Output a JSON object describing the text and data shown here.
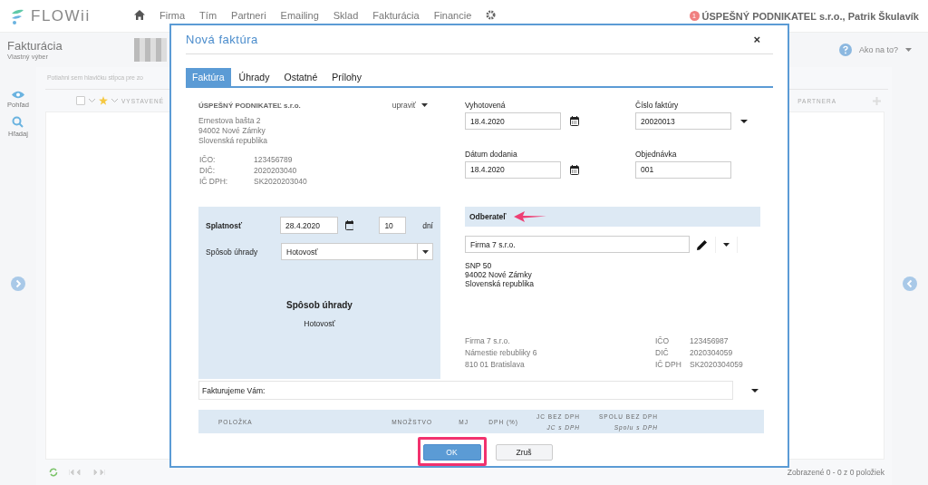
{
  "app": {
    "logo": "FLOWii",
    "nav": [
      "Firma",
      "Tím",
      "Partneri",
      "Emailing",
      "Sklad",
      "Fakturácia",
      "Financie"
    ],
    "notification_count": "1",
    "user": "ÚSPEŠNÝ PODNIKATEĽ s.r.o., Patrik Škulavík"
  },
  "page": {
    "title": "Fakturácia",
    "subtitle": "Vlastný výber",
    "help": "Ako na to?"
  },
  "sidebar": [
    {
      "label": "Pohľad",
      "kind": "view"
    },
    {
      "label": "Hľadaj",
      "kind": "search"
    }
  ],
  "grid": {
    "select_all_checked": false,
    "group_hint": "Potiahni sem hlavičku stĺpca pre zo",
    "columns": [
      "VYSTAVENÉ",
      "PARTNERA"
    ],
    "footer": "Zobrazené 0 - 0 z 0 položiek"
  },
  "dialog": {
    "title": "Nová faktúra",
    "close": "×",
    "tabs": [
      {
        "label": "Faktúra",
        "selected": true
      },
      {
        "label": "Úhrady",
        "selected": false
      },
      {
        "label": "Ostatné",
        "selected": false
      },
      {
        "label": "Prílohy",
        "selected": false
      }
    ],
    "supplier": {
      "name": "ÚSPEŠNÝ PODNIKATEĽ s.r.o.",
      "edit": "upraviť",
      "address": [
        "Ernestova bašta 2",
        "94002 Nové Zámky",
        "Slovenská republika"
      ],
      "ids": [
        {
          "label": "IČO:",
          "value": "123456789"
        },
        {
          "label": "DIČ:",
          "value": "2020203040"
        },
        {
          "label": "IČ DPH:",
          "value": "SK2020203040"
        }
      ]
    },
    "fields": [
      {
        "label": "Vyhotovená",
        "value": "18.4.2020",
        "kind": "date"
      },
      {
        "label": "Číslo faktúry",
        "value": "20020013",
        "kind": "dropdown"
      },
      {
        "label": "Dátum dodania",
        "value": "18.4.2020",
        "kind": "date"
      },
      {
        "label": "Objednávka",
        "value": "001",
        "kind": "text"
      }
    ],
    "payment": {
      "due_label": "Splatnosť",
      "due_date": "28.4.2020",
      "days": "10",
      "days_unit": "dní",
      "method_label": "Spôsob úhrady",
      "method": "Hotovosť",
      "summary_title": "Spôsob úhrady",
      "summary_value": "Hotovosť"
    },
    "customer": {
      "heading": "Odberateľ",
      "arrow": true,
      "name": "Firma 7 s.r.o.",
      "address": [
        "SNP 50",
        "94002 Nové Zámky",
        "Slovenská republika"
      ],
      "billing": [
        "Firma 7 s.r.o.",
        "Námestie rebubliky 6",
        "810 01 Bratislava"
      ],
      "ids": [
        {
          "label": "IČO",
          "value": "123456987"
        },
        {
          "label": "DIČ",
          "value": "2020304059"
        },
        {
          "label": "IČ DPH",
          "value": "SK2020304059"
        }
      ]
    },
    "intro_text": "Fakturujeme Vám:",
    "items_columns": [
      {
        "label": "POLOŽKA"
      },
      {
        "label": "MNOŽSTVO"
      },
      {
        "label": "MJ"
      },
      {
        "label": "DPH (%)"
      },
      {
        "label": "JC BEZ DPH",
        "sub": "JC s DPH"
      },
      {
        "label": "SPOLU BEZ DPH",
        "sub": "Spolu s DPH"
      }
    ],
    "buttons": [
      {
        "label": "OK",
        "kind": "primary",
        "highlighted": true
      },
      {
        "label": "Zruš",
        "kind": "secondary",
        "highlighted": false
      }
    ]
  }
}
